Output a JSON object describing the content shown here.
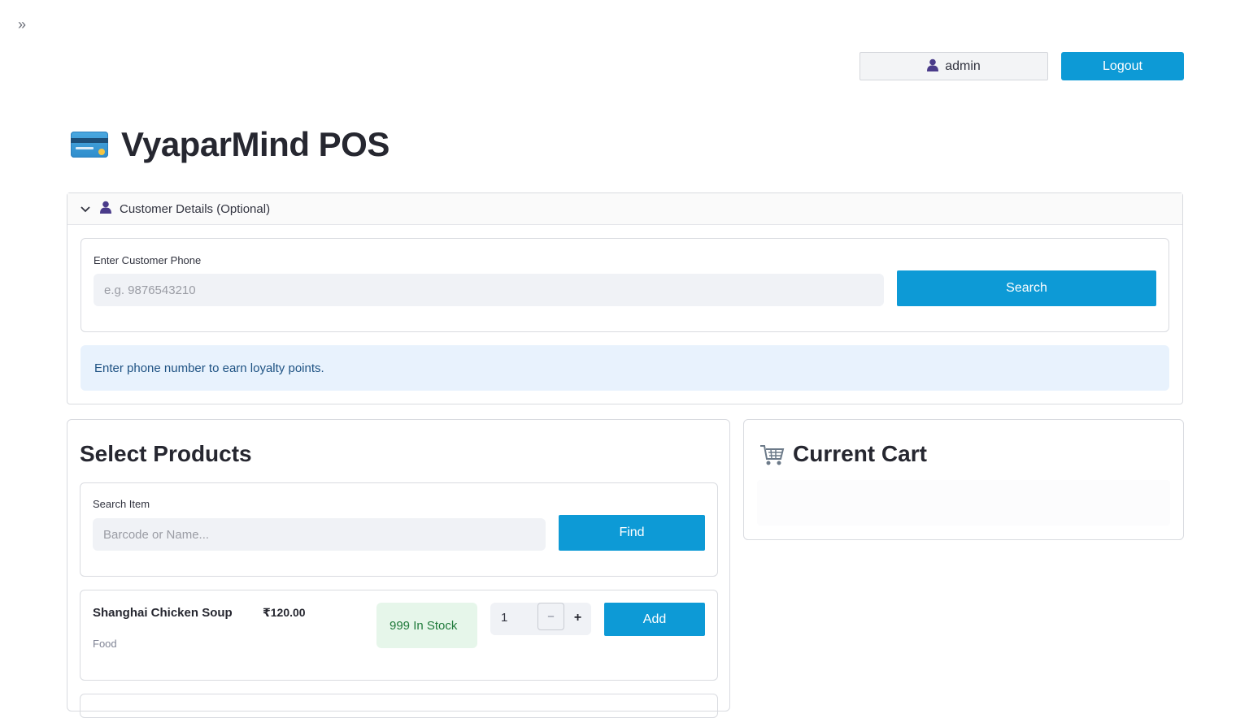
{
  "sidebar": {
    "toggle_icon": "double-chevron-right-icon",
    "toggle_glyph": "»"
  },
  "header": {
    "user_icon": "person-icon",
    "user_name": "admin",
    "logout_label": "Logout"
  },
  "page": {
    "icon": "credit-card-icon",
    "title": "VyaparMind POS"
  },
  "customer": {
    "expander_label": "Customer Details (Optional)",
    "expanded": true,
    "phone_label": "Enter Customer Phone",
    "phone_placeholder": "e.g. 9876543210",
    "phone_value": "",
    "search_label": "Search",
    "info_message": "Enter phone number to earn loyalty points."
  },
  "products": {
    "title": "Select Products",
    "search_label": "Search Item",
    "search_placeholder": "Barcode or Name...",
    "find_label": "Find",
    "items": [
      {
        "name": "Shanghai Chicken Soup",
        "price": "₹120.00",
        "category": "Food",
        "stock": "999 In Stock",
        "quantity": "1",
        "add_label": "Add"
      }
    ]
  },
  "cart": {
    "icon": "shopping-cart-icon",
    "title": "Current Cart"
  },
  "colors": {
    "primary": "#0d9ad6",
    "info_bg": "#e8f2fd",
    "info_text": "#1e5283",
    "stock_bg": "#e6f6ea",
    "stock_text": "#1f7a3a"
  }
}
